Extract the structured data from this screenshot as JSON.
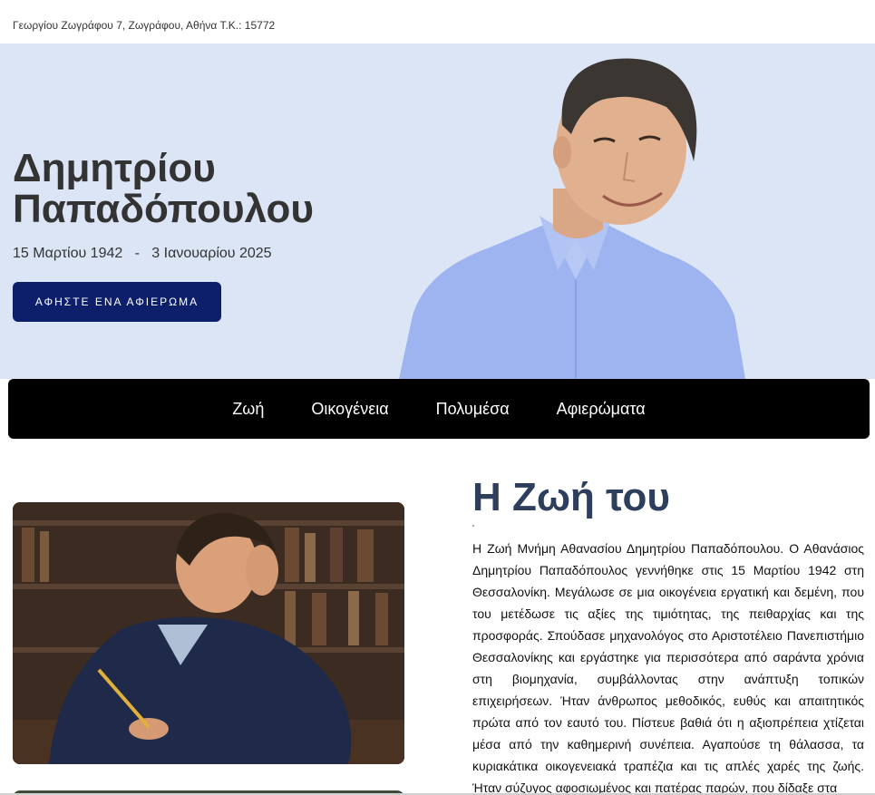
{
  "topbar": {
    "address": "Γεωργίου Ζωγράφου 7, Ζωγράφου, Αθήνα Τ.Κ.: 15772"
  },
  "hero": {
    "name_line1": "Δημητρίου",
    "name_line2": "Παπαδόπουλου",
    "birth_date": "15 Μαρτίου 1942",
    "separator": "-",
    "death_date": "3 Ιανουαρίου 2025",
    "cta_label": "ΑΦΗΣΤΕ ΕΝΑ ΑΦΙΕΡΩΜΑ"
  },
  "nav": {
    "items": [
      {
        "label": "Ζωή"
      },
      {
        "label": "Οικογένεια"
      },
      {
        "label": "Πολυμέσα"
      },
      {
        "label": "Αφιερώματα"
      }
    ]
  },
  "life": {
    "title": "Η Ζωή του",
    "text": "Η Ζωή Μνήμη Αθανασίου Δημητρίου Παπαδόπουλου. Ο Αθανάσιος Δημητρίου Παπαδόπουλος γεννήθηκε στις 15 Μαρτίου 1942 στη Θεσσαλονίκη. Μεγάλωσε σε μια οικογένεια εργατική και δεμένη, που του μετέδωσε τις αξίες της τιμιότητας, της πειθαρχίας και της προσφοράς. Σπούδασε μηχανολόγος στο Αριστοτέλειο Πανεπιστήμιο Θεσσαλονίκης και εργάστηκε για περισσότερα από σαράντα χρόνια στη βιομηχανία, συμβάλλοντας στην ανάπτυξη τοπικών επιχειρήσεων. Ήταν άνθρωπος μεθοδικός, ευθύς και απαιτητικός πρώτα από τον εαυτό του. Πίστευε βαθιά ότι η αξιοπρέπεια χτίζεται μέσα από την καθημερινή συνέπεια. Αγαπούσε τη θάλασσα, τα κυριακάτικα οικογενειακά τραπέζια και τις απλές χαρές της ζωής. Ήταν σύζυγος αφοσιωμένος και πατέρας παρών, που δίδαξε στα"
  },
  "colors": {
    "hero_bg": "#dce5f5",
    "cta_bg": "#0d1f6b",
    "nav_bg": "#000000",
    "title_color": "#2e3f5e",
    "shirt": "#9db4f0"
  }
}
